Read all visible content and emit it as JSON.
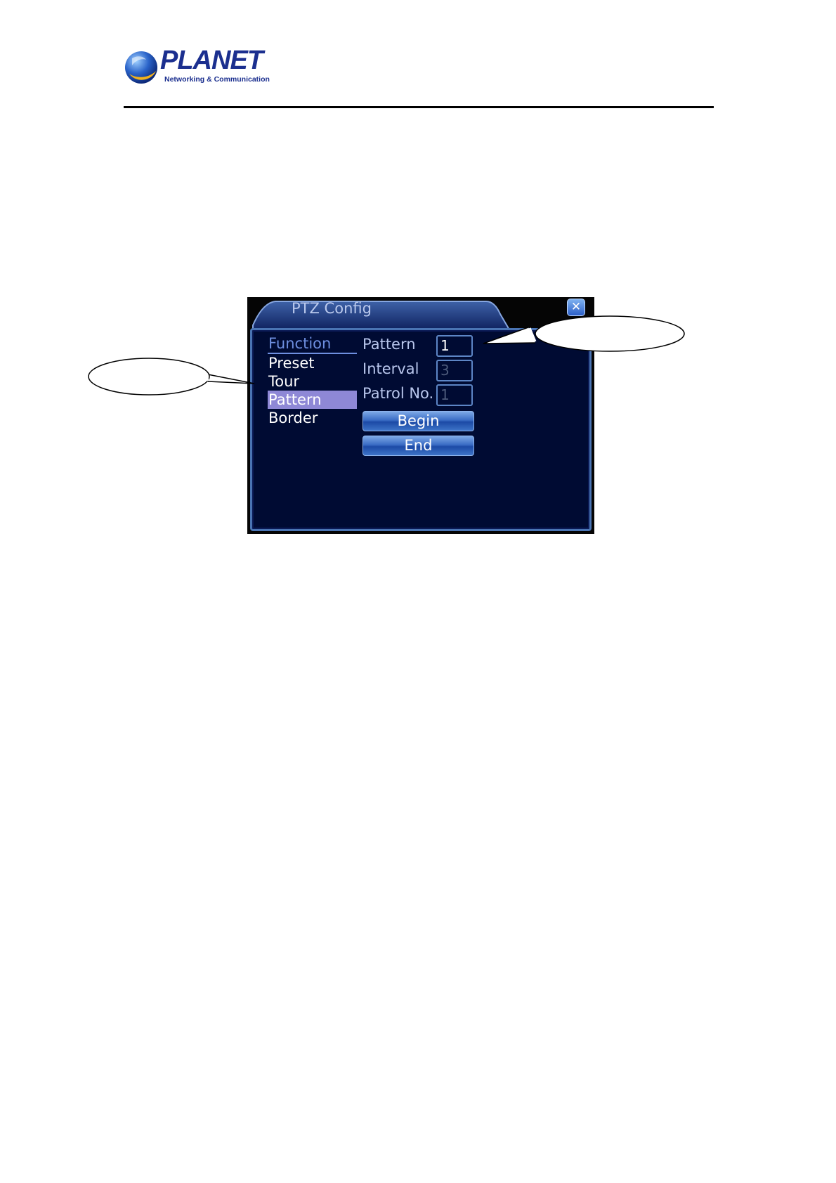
{
  "header": {
    "brand_name": "PLANET",
    "brand_tagline": "Networking & Communication"
  },
  "dialog": {
    "title": "PTZ Config",
    "close_icon": "close-icon",
    "menu": {
      "header": "Function",
      "items": [
        {
          "label": "Preset",
          "selected": false
        },
        {
          "label": "Tour",
          "selected": false
        },
        {
          "label": "Pattern",
          "selected": true
        },
        {
          "label": "Border",
          "selected": false
        }
      ]
    },
    "fields": [
      {
        "label": "Pattern",
        "value": "1",
        "enabled": true
      },
      {
        "label": "Interval",
        "value": "3",
        "enabled": false
      },
      {
        "label": "Patrol No.",
        "value": "1",
        "enabled": false
      }
    ],
    "buttons": {
      "begin": "Begin",
      "end": "End"
    }
  },
  "colors": {
    "dialog_body": "#000b33",
    "menu_highlight": "#8e88d6",
    "border_blue": "#4a74b3",
    "brand_blue": "#1b2f8f"
  }
}
